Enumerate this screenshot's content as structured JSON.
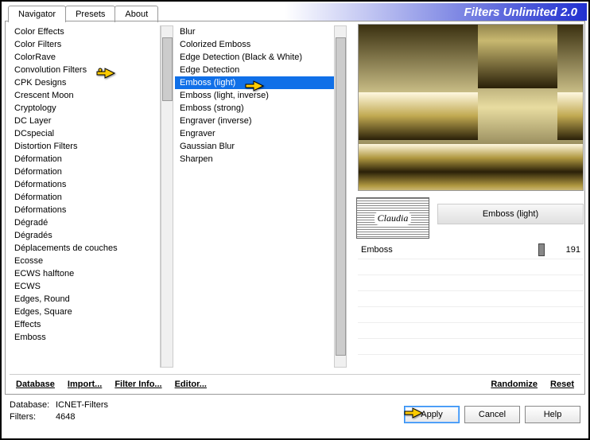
{
  "app_title": "Filters Unlimited 2.0",
  "tabs": {
    "navigator": "Navigator",
    "presets": "Presets",
    "about": "About"
  },
  "categories": [
    "Color Effects",
    "Color Filters",
    "ColorRave",
    "Convolution Filters",
    "CPK Designs",
    "Crescent Moon",
    "Cryptology",
    "DC Layer",
    "DCspecial",
    "Distortion Filters",
    "Déformation",
    "Déformation",
    "Déformations",
    "Déformation",
    "Déformations",
    "Dégradé",
    "Dégradés",
    "Déplacements de couches",
    "Ecosse",
    "ECWS halftone",
    "ECWS",
    "Edges, Round",
    "Edges, Square",
    "Effects",
    "Emboss"
  ],
  "selected_category_index": 3,
  "filters": [
    "Blur",
    "Colorized Emboss",
    "Edge Detection (Black & White)",
    "Edge Detection",
    "Emboss (light)",
    "Emboss (light, inverse)",
    "Emboss (strong)",
    "Engraver (inverse)",
    "Engraver",
    "Gaussian Blur",
    "Sharpen"
  ],
  "selected_filter_index": 4,
  "logo_text": "Claudia",
  "current_filter_name": "Emboss (light)",
  "params": [
    {
      "name": "Emboss",
      "value": "191"
    }
  ],
  "bottom": {
    "database": "Database",
    "import": "Import...",
    "filter_info": "Filter Info...",
    "editor": "Editor...",
    "randomize": "Randomize",
    "reset": "Reset"
  },
  "status": {
    "db_label": "Database:",
    "db_value": "ICNET-Filters",
    "filters_label": "Filters:",
    "filters_value": "4648"
  },
  "dialog": {
    "apply": "Apply",
    "cancel": "Cancel",
    "help": "Help"
  }
}
